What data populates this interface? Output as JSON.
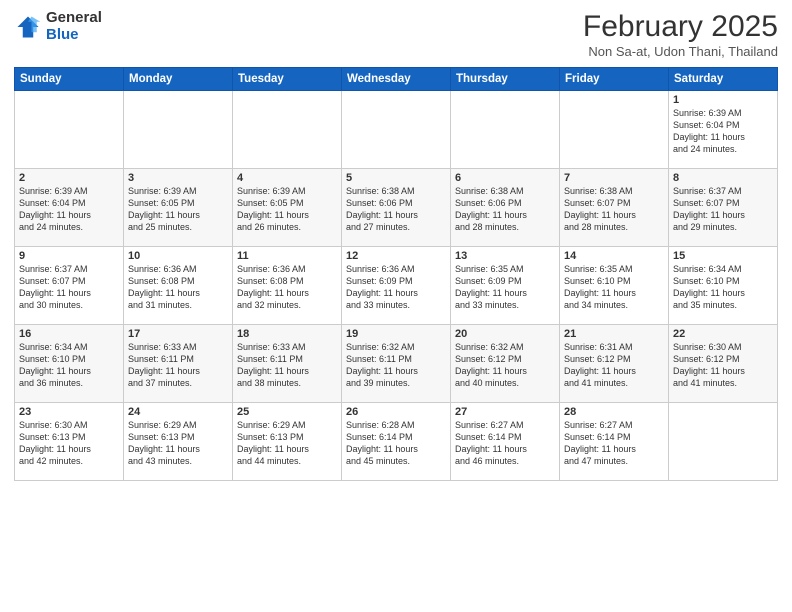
{
  "header": {
    "logo_general": "General",
    "logo_blue": "Blue",
    "title": "February 2025",
    "location": "Non Sa-at, Udon Thani, Thailand"
  },
  "weekdays": [
    "Sunday",
    "Monday",
    "Tuesday",
    "Wednesday",
    "Thursday",
    "Friday",
    "Saturday"
  ],
  "weeks": [
    [
      {
        "day": "",
        "info": ""
      },
      {
        "day": "",
        "info": ""
      },
      {
        "day": "",
        "info": ""
      },
      {
        "day": "",
        "info": ""
      },
      {
        "day": "",
        "info": ""
      },
      {
        "day": "",
        "info": ""
      },
      {
        "day": "1",
        "info": "Sunrise: 6:39 AM\nSunset: 6:04 PM\nDaylight: 11 hours\nand 24 minutes."
      }
    ],
    [
      {
        "day": "2",
        "info": "Sunrise: 6:39 AM\nSunset: 6:04 PM\nDaylight: 11 hours\nand 24 minutes."
      },
      {
        "day": "3",
        "info": "Sunrise: 6:39 AM\nSunset: 6:05 PM\nDaylight: 11 hours\nand 25 minutes."
      },
      {
        "day": "4",
        "info": "Sunrise: 6:39 AM\nSunset: 6:05 PM\nDaylight: 11 hours\nand 26 minutes."
      },
      {
        "day": "5",
        "info": "Sunrise: 6:38 AM\nSunset: 6:06 PM\nDaylight: 11 hours\nand 27 minutes."
      },
      {
        "day": "6",
        "info": "Sunrise: 6:38 AM\nSunset: 6:06 PM\nDaylight: 11 hours\nand 28 minutes."
      },
      {
        "day": "7",
        "info": "Sunrise: 6:38 AM\nSunset: 6:07 PM\nDaylight: 11 hours\nand 28 minutes."
      },
      {
        "day": "8",
        "info": "Sunrise: 6:37 AM\nSunset: 6:07 PM\nDaylight: 11 hours\nand 29 minutes."
      }
    ],
    [
      {
        "day": "9",
        "info": "Sunrise: 6:37 AM\nSunset: 6:07 PM\nDaylight: 11 hours\nand 30 minutes."
      },
      {
        "day": "10",
        "info": "Sunrise: 6:36 AM\nSunset: 6:08 PM\nDaylight: 11 hours\nand 31 minutes."
      },
      {
        "day": "11",
        "info": "Sunrise: 6:36 AM\nSunset: 6:08 PM\nDaylight: 11 hours\nand 32 minutes."
      },
      {
        "day": "12",
        "info": "Sunrise: 6:36 AM\nSunset: 6:09 PM\nDaylight: 11 hours\nand 33 minutes."
      },
      {
        "day": "13",
        "info": "Sunrise: 6:35 AM\nSunset: 6:09 PM\nDaylight: 11 hours\nand 33 minutes."
      },
      {
        "day": "14",
        "info": "Sunrise: 6:35 AM\nSunset: 6:10 PM\nDaylight: 11 hours\nand 34 minutes."
      },
      {
        "day": "15",
        "info": "Sunrise: 6:34 AM\nSunset: 6:10 PM\nDaylight: 11 hours\nand 35 minutes."
      }
    ],
    [
      {
        "day": "16",
        "info": "Sunrise: 6:34 AM\nSunset: 6:10 PM\nDaylight: 11 hours\nand 36 minutes."
      },
      {
        "day": "17",
        "info": "Sunrise: 6:33 AM\nSunset: 6:11 PM\nDaylight: 11 hours\nand 37 minutes."
      },
      {
        "day": "18",
        "info": "Sunrise: 6:33 AM\nSunset: 6:11 PM\nDaylight: 11 hours\nand 38 minutes."
      },
      {
        "day": "19",
        "info": "Sunrise: 6:32 AM\nSunset: 6:11 PM\nDaylight: 11 hours\nand 39 minutes."
      },
      {
        "day": "20",
        "info": "Sunrise: 6:32 AM\nSunset: 6:12 PM\nDaylight: 11 hours\nand 40 minutes."
      },
      {
        "day": "21",
        "info": "Sunrise: 6:31 AM\nSunset: 6:12 PM\nDaylight: 11 hours\nand 41 minutes."
      },
      {
        "day": "22",
        "info": "Sunrise: 6:30 AM\nSunset: 6:12 PM\nDaylight: 11 hours\nand 41 minutes."
      }
    ],
    [
      {
        "day": "23",
        "info": "Sunrise: 6:30 AM\nSunset: 6:13 PM\nDaylight: 11 hours\nand 42 minutes."
      },
      {
        "day": "24",
        "info": "Sunrise: 6:29 AM\nSunset: 6:13 PM\nDaylight: 11 hours\nand 43 minutes."
      },
      {
        "day": "25",
        "info": "Sunrise: 6:29 AM\nSunset: 6:13 PM\nDaylight: 11 hours\nand 44 minutes."
      },
      {
        "day": "26",
        "info": "Sunrise: 6:28 AM\nSunset: 6:14 PM\nDaylight: 11 hours\nand 45 minutes."
      },
      {
        "day": "27",
        "info": "Sunrise: 6:27 AM\nSunset: 6:14 PM\nDaylight: 11 hours\nand 46 minutes."
      },
      {
        "day": "28",
        "info": "Sunrise: 6:27 AM\nSunset: 6:14 PM\nDaylight: 11 hours\nand 47 minutes."
      },
      {
        "day": "",
        "info": ""
      }
    ]
  ]
}
